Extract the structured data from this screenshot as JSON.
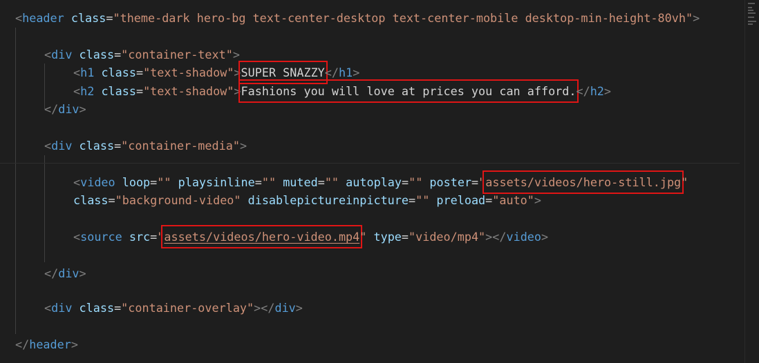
{
  "lines": {
    "l1": {
      "open": "<",
      "tag": "header",
      "attr1": "class",
      "eq": "=",
      "val1": "\"theme-dark hero-bg text-center-desktop text-center-mobile desktop-min-height-80vh\"",
      "close": ">"
    },
    "l3": {
      "open": "<",
      "tag": "div",
      "attr1": "class",
      "eq": "=",
      "val1": "\"container-text\"",
      "close": ">"
    },
    "l4": {
      "open": "<",
      "tag": "h1",
      "attr1": "class",
      "eq": "=",
      "val1": "\"text-shadow\"",
      "close": ">",
      "content": "SUPER SNAZZY",
      "endopen": "</",
      "endtag": "h1",
      "endclose": ">"
    },
    "l5": {
      "open": "<",
      "tag": "h2",
      "attr1": "class",
      "eq": "=",
      "val1": "\"text-shadow\"",
      "close": ">",
      "content": "Fashions you will love at prices you can afford.",
      "endopen": "</",
      "endtag": "h2",
      "endclose": ">"
    },
    "l6": {
      "endopen": "</",
      "endtag": "div",
      "endclose": ">"
    },
    "l8": {
      "open": "<",
      "tag": "div",
      "attr1": "class",
      "eq": "=",
      "val1": "\"container-media\"",
      "close": ">"
    },
    "l10": {
      "open": "<",
      "tag": "video",
      "a1": "loop",
      "v1": "\"\"",
      "a2": "playsinline",
      "v2": "\"\"",
      "a3": "muted",
      "v3": "\"\"",
      "a4": "autoplay",
      "v4": "\"\"",
      "a5": "poster",
      "q5": "\"",
      "v5": "assets/videos/hero-still.jpg",
      "q5b": "\"",
      "eq": "="
    },
    "l11": {
      "a1": "class",
      "v1": "\"background-video\"",
      "a2": "disablepictureinpicture",
      "v2": "\"\"",
      "a3": "preload",
      "v3": "\"auto\"",
      "close": ">",
      "eq": "="
    },
    "l13": {
      "open": "<",
      "tag": "source",
      "a1": "src",
      "q1": "\"",
      "v1": "assets/videos/hero-video.mp4",
      "q1b": "\"",
      "a2": "type",
      "v2": "\"video/mp4\"",
      "close": ">",
      "endopen": "</",
      "endtag": "video",
      "endclose": ">",
      "eq": "="
    },
    "l15": {
      "endopen": "</",
      "endtag": "div",
      "endclose": ">"
    },
    "l17": {
      "open": "<",
      "tag": "div",
      "attr1": "class",
      "eq": "=",
      "val1": "\"container-overlay\"",
      "close": ">",
      "endopen": "</",
      "endtag": "div",
      "endclose": ">"
    },
    "l19": {
      "endopen": "</",
      "endtag": "header",
      "endclose": ">"
    }
  },
  "colors": {
    "background": "#1e1e1e",
    "tag": "#569cd6",
    "attribute": "#9cdcfe",
    "string": "#ce9178",
    "punctuation": "#808080",
    "text": "#d4d4d4",
    "highlight_box": "#e01515"
  }
}
